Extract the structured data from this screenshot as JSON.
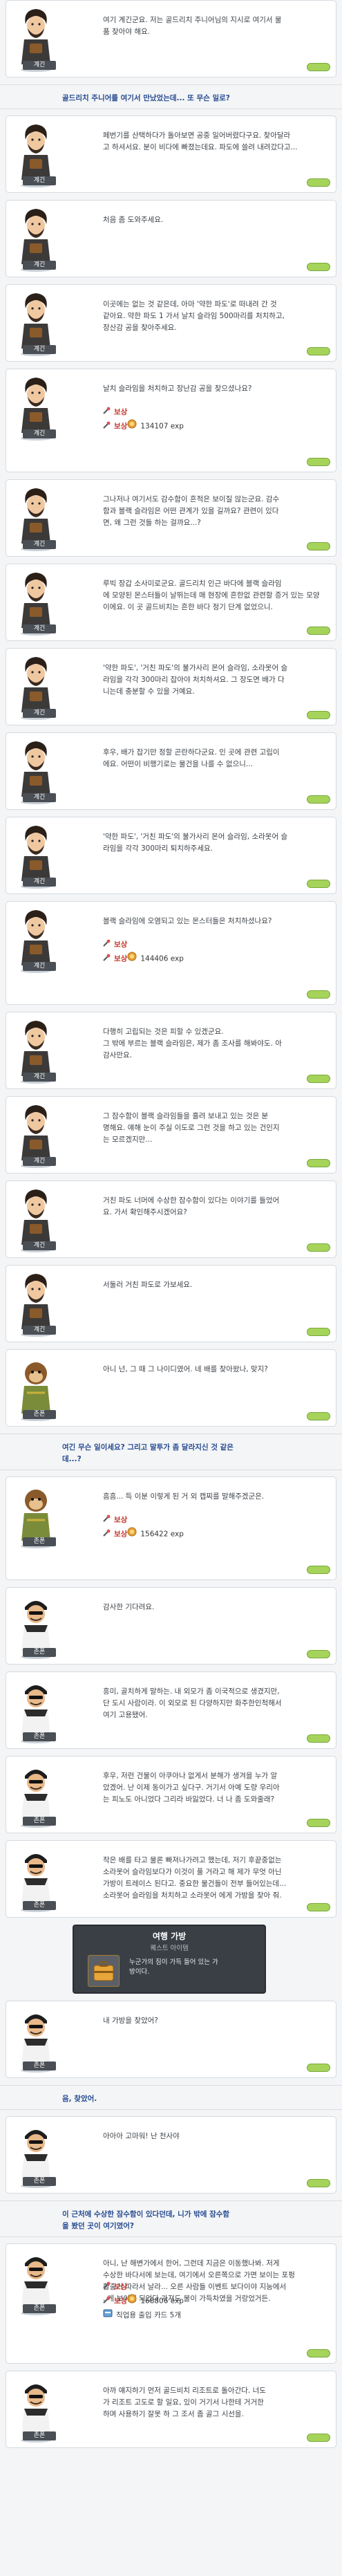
{
  "next_button_label": "NEXT",
  "colors": {
    "accent": "#254a91",
    "reward": "#c2362b",
    "next": "#a6d45b"
  },
  "entries": [
    {
      "type": "npc",
      "npc": "rowen",
      "name": "계긴",
      "text": "여기 계긴군요. 저는 골드리치 주니어님의 지시로 여기서 물\n품 찾아야 해요."
    },
    {
      "type": "choice",
      "text": "골드리치 주니어를 여기서 만났었는데... 또 무슨 일로?"
    },
    {
      "type": "npc",
      "npc": "rowen",
      "name": "계긴",
      "text": "페번기를 산택하다가 돌아보면 공중 일어버렸다구요. 찾아달라\n고 하셔서요. 분이 비다에 빠졌는데요. 파도에 쓸려 내려갔다고..."
    },
    {
      "type": "npc",
      "npc": "rowen",
      "name": "계긴",
      "text": "처음 좀 도와주세요."
    },
    {
      "type": "npc",
      "npc": "rowen",
      "name": "계긴",
      "text": "이곳에는 없는 것 같은데, 아마 '약한 파도'로 떠내려 간 것\n같아요. 약한 파도 1 가서 날치 슬라임 500마리를 처치하고,\n장산감 공을 찾아주세요."
    },
    {
      "type": "npc",
      "npc": "rowen",
      "name": "계긴",
      "text": "날치 슬라임을 처치하고 장난감 공을 찾으셨나요?",
      "reward": {
        "label": "보상",
        "exp": "134107 exp"
      }
    },
    {
      "type": "npc",
      "npc": "rowen",
      "name": "계긴",
      "text": "그나저나 여기서도 감수함이 흔적은 보이질 않는군요. 감수\n함과 블랙 슬라임은 어떤 관계가 있을 길까요? 관련이 있다\n면, 왜 그런 것들 하는 걸까요...?"
    },
    {
      "type": "npc",
      "npc": "rowen",
      "name": "계긴",
      "text": "루빅 장갑 소사미로군요. 골드리치 인근 바다에 블랙 슬라임\n에 모양된 몬스터들이 날뛰는데 매 현장에 흔한없 관련할 증거 있는 모양이에요. 이 곳 골드비치는 흔한 바다 정기 단계 없었으니."
    },
    {
      "type": "npc",
      "npc": "rowen",
      "name": "계긴",
      "text": "'약한 파도', '거친 파도'의 불가사리 몬어 슬라임, 소라못어 슬\n라임을 각각 300마리 잡아야 처치하셔요. 그 장도면 배가 다\n니는데 충분할 수 있을 거예요."
    },
    {
      "type": "npc",
      "npc": "rowen",
      "name": "계긴",
      "text": "후우, 배가 잡기만 정할 곤란하다군요. 인 곳에 관련 고립이\n에요. 어떤이 비행기로는 물건을 나를 수 없으니..."
    },
    {
      "type": "npc",
      "npc": "rowen",
      "name": "계긴",
      "text": "'약한 파도', '거친 파도'의 불가사리 몬어 슬라임, 소라못어 슬\n라임을 각각 300마리 퇴치하주세요."
    },
    {
      "type": "npc",
      "npc": "rowen",
      "name": "계긴",
      "text": "블랙 슬라임에 오염되고 있는 몬스터들은 처치하셨나요?",
      "reward": {
        "label": "보상",
        "exp": "144406 exp"
      }
    },
    {
      "type": "npc",
      "npc": "rowen",
      "name": "계긴",
      "text": "다행히 고립되는 것은 피할 수 있겠군요.\n그 밖에 부르는 블랙 슬라임은, 제가 좀 조사를 해봐야도. 아\n감사만요."
    },
    {
      "type": "npc",
      "npc": "rowen",
      "name": "계긴",
      "text": "그 잠수함이 블랙 슬라임들을 흘려 보내고 있는 것은 분\n명해요. 얘해 눈이 주실 이도로 그런 것을 하고 있는 건인지\n는 모르겠지만..."
    },
    {
      "type": "npc",
      "npc": "rowen",
      "name": "계긴",
      "text": "거친 파도 너머에 수상한 잠수함이 있다는 이야기를 들었어\n요. 가서 확인해주시겠어요?"
    },
    {
      "type": "npc",
      "npc": "rowen",
      "name": "계긴",
      "text": "서둘러 거친 파도로 가보세요."
    },
    {
      "type": "npc",
      "npc": "monkey",
      "name": "존폰",
      "text": "아니 넌, 그 때 그 나이디였어. 네 배를 찾아왔나, 맞지?"
    },
    {
      "type": "choice",
      "text": "여긴 무슨 일이세요? 그리고 말투가 좀 달라지신 것 같은\n데...?"
    },
    {
      "type": "npc",
      "npc": "monkey",
      "name": "존폰",
      "text": "흠흠... 득 이분 이렇게 된 거 외 캡찌를 말해주겠군은.",
      "reward": {
        "label": "보상",
        "exp": "156422 exp"
      }
    },
    {
      "type": "npc",
      "npc": "pirate",
      "name": "존폰",
      "text": "감사한 기다려요."
    },
    {
      "type": "npc",
      "npc": "pirate",
      "name": "존폰",
      "text": "흥미, 골치하게 말하는. 내 외모가 좀 이국적으로 생겼지만,\n단 도시 사람이라. 이 외모로 된 다양하지만 화주한인척해서\n여기 고용됐어."
    },
    {
      "type": "npc",
      "npc": "pirate",
      "name": "존폰",
      "text": "후우, 저런 건물이 아쿠아나 없게서 분해가 생겨을 누가 알\n았겠어. 난 이제 동이가고 싶다구. 거기서 아예 도량 우리아\n는 피노도 아니었다 그리라 바잃었다. 너 나 좀 도와줄래?"
    },
    {
      "type": "npc",
      "npc": "pirate",
      "name": "존폰",
      "text": "작은 배를 타고 물론 빠져나가려고 했는데, 저기 후끝중없는\n소라못어 슬라임보다가 이것이 풀 거라고 해 제가 무엇 아닌\n가방이 트레이스 된다고. 중요한 물건들이 전부 들어있는데...\n소라못어 슬라임을 처치하고 소라못어 에게 가방을 찾아 줘."
    },
    {
      "type": "item",
      "title": "여행 가방",
      "subtitle": "퀘스트 아이템",
      "desc": "누군가의 짐이 가득 들어 있는 가\n방이다."
    },
    {
      "type": "npc",
      "npc": "pirate",
      "name": "존폰",
      "text": "내 가방을 찾았어?"
    },
    {
      "type": "choice",
      "text": "음, 찾았어."
    },
    {
      "type": "npc",
      "npc": "pirate",
      "name": "존폰",
      "text": "아아아 고마워! 난 천사야"
    },
    {
      "type": "choice",
      "text": "이 근처에 수상한 잠수함이 있다던데, 니가 밖에 잠수함\n을 봤던 곳이 여기였어?"
    },
    {
      "type": "npc",
      "npc": "pirate",
      "name": "존폰",
      "text": "아니, 난 해변가에서 한어, 그런데 지금은 이동했나봐. 저게\n수상한 바다서에 보는데, 여기에서 오른쪽으로 가면 보이는 포펑\n활출거 따라서 날라... 오른 사람들 이벤트 보다이야 지능에서\n. 게 보이게 되었다 가져도 물이 가득차였을 거랑었거든.",
      "reward": {
        "label": "보상",
        "exp": "168806 exp",
        "extra": "직업용 출입 카드 5개"
      }
    },
    {
      "type": "npc",
      "npc": "pirate",
      "name": "존폰",
      "text": "아까 얘지하기 먼저 골드비치 리조트로 돌아간다. 너도\n가 리조트 고도로 할 일요, 있이 거기서 나한테 거거한\n하며 사용하기 잘못 하 그 조서 좀 골그 시선을."
    }
  ]
}
